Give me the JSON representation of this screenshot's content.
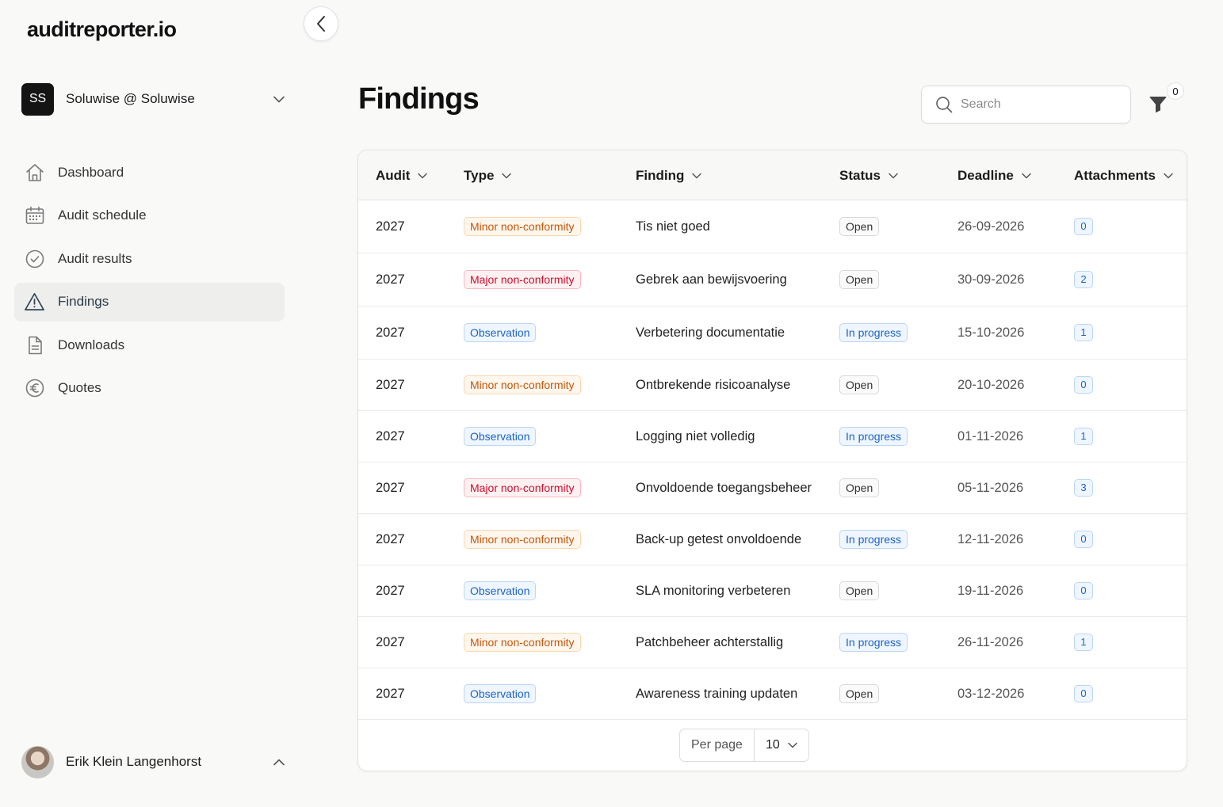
{
  "app": {
    "logo": "auditreporter.io"
  },
  "org": {
    "initials": "SS",
    "name": "Soluwise @ Soluwise"
  },
  "nav": [
    {
      "label": "Dashboard",
      "icon": "home-icon",
      "active": false
    },
    {
      "label": "Audit schedule",
      "icon": "calendar-icon",
      "active": false
    },
    {
      "label": "Audit results",
      "icon": "check-circle-icon",
      "active": false
    },
    {
      "label": "Findings",
      "icon": "warning-icon",
      "active": true
    },
    {
      "label": "Downloads",
      "icon": "document-icon",
      "active": false
    },
    {
      "label": "Quotes",
      "icon": "euro-icon",
      "active": false
    }
  ],
  "user": {
    "name": "Erik Klein Langenhorst"
  },
  "page": {
    "title": "Findings"
  },
  "search": {
    "placeholder": "Search"
  },
  "filter": {
    "count": "0"
  },
  "table": {
    "columns": [
      "Audit",
      "Type",
      "Finding",
      "Status",
      "Deadline",
      "Attachments"
    ],
    "rows": [
      {
        "audit": "2027",
        "type": "Minor non-conformity",
        "type_kind": "minor",
        "finding": "Tis niet goed",
        "status": "Open",
        "status_kind": "open",
        "deadline": "26-09-2026",
        "attachments": "0"
      },
      {
        "audit": "2027",
        "type": "Major non-conformity",
        "type_kind": "major",
        "finding": "Gebrek aan bewijsvoering",
        "status": "Open",
        "status_kind": "open",
        "deadline": "30-09-2026",
        "attachments": "2"
      },
      {
        "audit": "2027",
        "type": "Observation",
        "type_kind": "obs",
        "finding": "Verbetering documentatie",
        "status": "In progress",
        "status_kind": "prog",
        "deadline": "15-10-2026",
        "attachments": "1"
      },
      {
        "audit": "2027",
        "type": "Minor non-conformity",
        "type_kind": "minor",
        "finding": "Ontbrekende risicoanalyse",
        "status": "Open",
        "status_kind": "open",
        "deadline": "20-10-2026",
        "attachments": "0"
      },
      {
        "audit": "2027",
        "type": "Observation",
        "type_kind": "obs",
        "finding": "Logging niet volledig",
        "status": "In progress",
        "status_kind": "prog",
        "deadline": "01-11-2026",
        "attachments": "1"
      },
      {
        "audit": "2027",
        "type": "Major non-conformity",
        "type_kind": "major",
        "finding": "Onvoldoende toegangsbeheer",
        "status": "Open",
        "status_kind": "open",
        "deadline": "05-11-2026",
        "attachments": "3"
      },
      {
        "audit": "2027",
        "type": "Minor non-conformity",
        "type_kind": "minor",
        "finding": "Back-up getest onvoldoende",
        "status": "In progress",
        "status_kind": "prog",
        "deadline": "12-11-2026",
        "attachments": "0"
      },
      {
        "audit": "2027",
        "type": "Observation",
        "type_kind": "obs",
        "finding": "SLA monitoring verbeteren",
        "status": "Open",
        "status_kind": "open",
        "deadline": "19-11-2026",
        "attachments": "0"
      },
      {
        "audit": "2027",
        "type": "Minor non-conformity",
        "type_kind": "minor",
        "finding": "Patchbeheer achterstallig",
        "status": "In progress",
        "status_kind": "prog",
        "deadline": "26-11-2026",
        "attachments": "1"
      },
      {
        "audit": "2027",
        "type": "Observation",
        "type_kind": "obs",
        "finding": "Awareness training updaten",
        "status": "Open",
        "status_kind": "open",
        "deadline": "03-12-2026",
        "attachments": "0"
      }
    ]
  },
  "pagination": {
    "label": "Per page",
    "value": "10"
  }
}
